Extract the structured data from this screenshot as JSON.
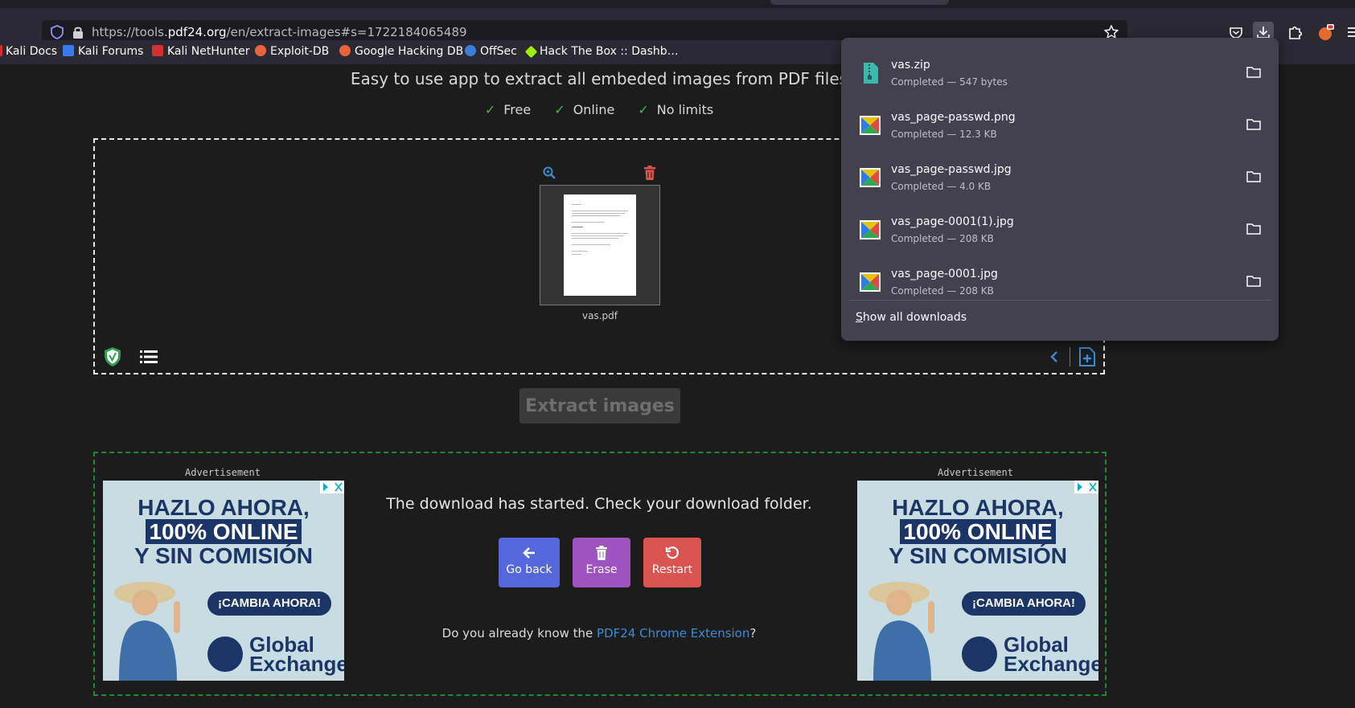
{
  "browser": {
    "url_prefix": "https://tools.",
    "url_domain": "pdf24.org",
    "url_path": "/en/extract-images#s=1722184065489"
  },
  "bookmarks": [
    {
      "label": "Kali Docs",
      "icon": "kali-icon",
      "color": "#367bf0"
    },
    {
      "label": "Kali Forums",
      "icon": "kali-icon",
      "color": "#367bf0"
    },
    {
      "label": "Kali NetHunter",
      "icon": "nethunter-icon",
      "color": "#d32f2f"
    },
    {
      "label": "Exploit-DB",
      "icon": "exploitdb-icon",
      "color": "#e8643c"
    },
    {
      "label": "Google Hacking DB",
      "icon": "ghdb-icon",
      "color": "#e8643c"
    },
    {
      "label": "OffSec",
      "icon": "offsec-icon",
      "color": "#3b7ddd"
    },
    {
      "label": "Hack The Box :: Dashb…",
      "icon": "htb-icon",
      "color": "#9fef00"
    }
  ],
  "page": {
    "subtitle": "Easy to use app to extract all embeded images from PDF files",
    "features": [
      "Free",
      "Online",
      "No limits"
    ],
    "file_name": "vas.pdf",
    "extract_button": "Extract images",
    "ad_label": "Advertisement",
    "download_message": "The download has started. Check your download folder.",
    "buttons": {
      "back": "Go back",
      "erase": "Erase",
      "restart": "Restart"
    },
    "extension_prefix": "Do you already know the ",
    "extension_link": "PDF24 Chrome Extension",
    "extension_suffix": "?"
  },
  "ad": {
    "line1": "HAZLO AHORA,",
    "line2": "100% ONLINE",
    "line3": "Y SIN COMISIÓN",
    "cta": "¡CAMBIA AHORA!",
    "brand1": "Global",
    "brand2": "Exchange"
  },
  "downloads": {
    "items": [
      {
        "name": "vas.zip",
        "status": "Completed — 547 bytes",
        "icon": "zip-file-icon"
      },
      {
        "name": "vas_page-passwd.png",
        "status": "Completed — 12.3 KB",
        "icon": "image-file-icon"
      },
      {
        "name": "vas_page-passwd.jpg",
        "status": "Completed — 4.0 KB",
        "icon": "image-file-icon"
      },
      {
        "name": "vas_page-0001(1).jpg",
        "status": "Completed — 208 KB",
        "icon": "image-file-icon"
      },
      {
        "name": "vas_page-0001.jpg",
        "status": "Completed — 208 KB",
        "icon": "image-file-icon"
      }
    ],
    "show_all_first": "S",
    "show_all_rest": "how all downloads"
  },
  "colors": {
    "accent_back": "#5468db",
    "accent_erase": "#9e53c0",
    "accent_restart": "#d9534f",
    "ad_border": "#1e8c2e"
  }
}
